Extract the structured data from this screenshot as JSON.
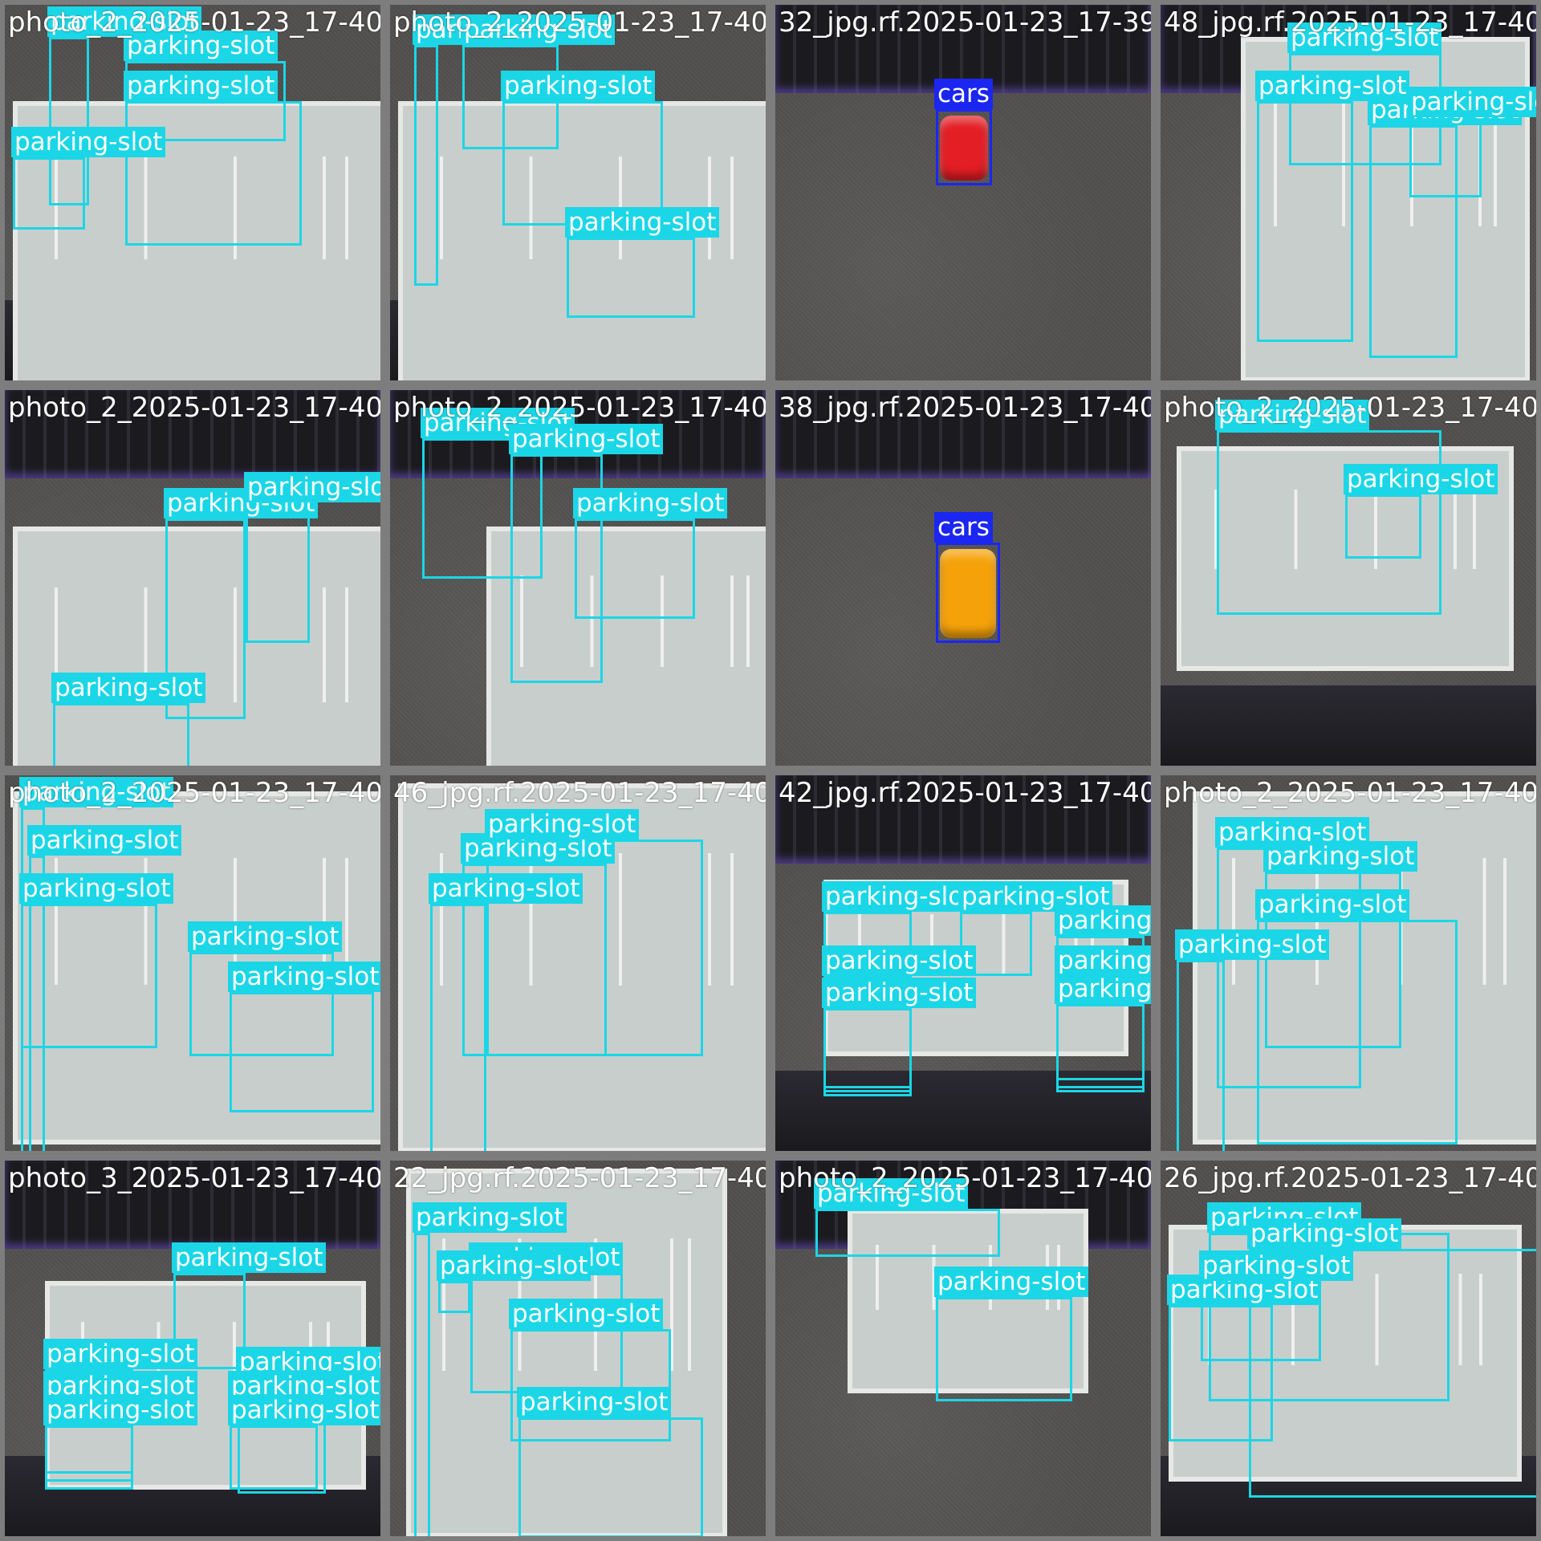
{
  "colors": {
    "slot_box": "#1bd6e6",
    "car_box": "#1b26f0",
    "label_text": "#ffffff",
    "grid_border": "#7d7d7d"
  },
  "tiles": [
    {
      "title": "photo_2_2025-01-23_17-40-",
      "labels": [
        "parking-slot",
        "parking-slot",
        "parking-slot",
        "parking-slot"
      ]
    },
    {
      "title": "photo_2_2025-01-23_17-40-",
      "labels": [
        "parking-slot",
        "parking-slot",
        "parking-slot",
        "parking-slot"
      ]
    },
    {
      "title": "32_jpg.rf.2025-01-23_17-39-",
      "labels": [
        "cars"
      ]
    },
    {
      "title": "48_jpg.rf.2025-01-23_17-40-",
      "labels": [
        "parking-slot",
        "parking-slot",
        "parking-slot",
        "parking-slot"
      ]
    },
    {
      "title": "photo_2_2025-01-23_17-40-",
      "labels": [
        "parking-slot",
        "parking-slot",
        "parking-slot"
      ]
    },
    {
      "title": "photo_2_2025-01-23_17-40-",
      "labels": [
        "parking-slot",
        "parking-slot",
        "parking-slot"
      ]
    },
    {
      "title": "38_jpg.rf.2025-01-23_17-40-",
      "labels": [
        "cars"
      ]
    },
    {
      "title": "photo_2_2025-01-23_17-40-",
      "labels": [
        "parking-slot",
        "parking-slot"
      ]
    },
    {
      "title": "photo_2_2025-01-23_17-40-",
      "labels": [
        "parking-slot",
        "parking-slot",
        "parking-slot",
        "parking-slot",
        "parking-slot"
      ]
    },
    {
      "title": "46_jpg.rf.2025-01-23_17-40-",
      "labels": [
        "parking-slot",
        "parking-slot",
        "parking-slot"
      ]
    },
    {
      "title": "42_jpg.rf.2025-01-23_17-40-",
      "labels": [
        "parking-slot",
        "parking-slot",
        "parking-slot",
        "parking-slot",
        "parking-slot",
        "parking-slot",
        "parking-slot"
      ]
    },
    {
      "title": "photo_2_2025-01-23_17-40-",
      "labels": [
        "parking-slot",
        "parking-slot",
        "parking-slot",
        "parking-slot"
      ]
    },
    {
      "title": "photo_3_2025-01-23_17-40-",
      "labels": [
        "parking-slot",
        "parking-slot",
        "parking-slot",
        "parking-slot",
        "parking-slot",
        "parking-slot",
        "parking-slot"
      ]
    },
    {
      "title": "22_jpg.rf.2025-01-23_17-40-",
      "labels": [
        "parking-slot",
        "parking-slot",
        "parking-slot",
        "parking-slot",
        "parking-slot"
      ]
    },
    {
      "title": "photo_2_2025-01-23_17-40-",
      "labels": [
        "parking-slot",
        "parking-slot"
      ]
    },
    {
      "title": "26_jpg.rf.2025-01-23_17-40-",
      "labels": [
        "parking-slot",
        "parking-slot",
        "parking-slot",
        "parking-slot"
      ]
    }
  ]
}
